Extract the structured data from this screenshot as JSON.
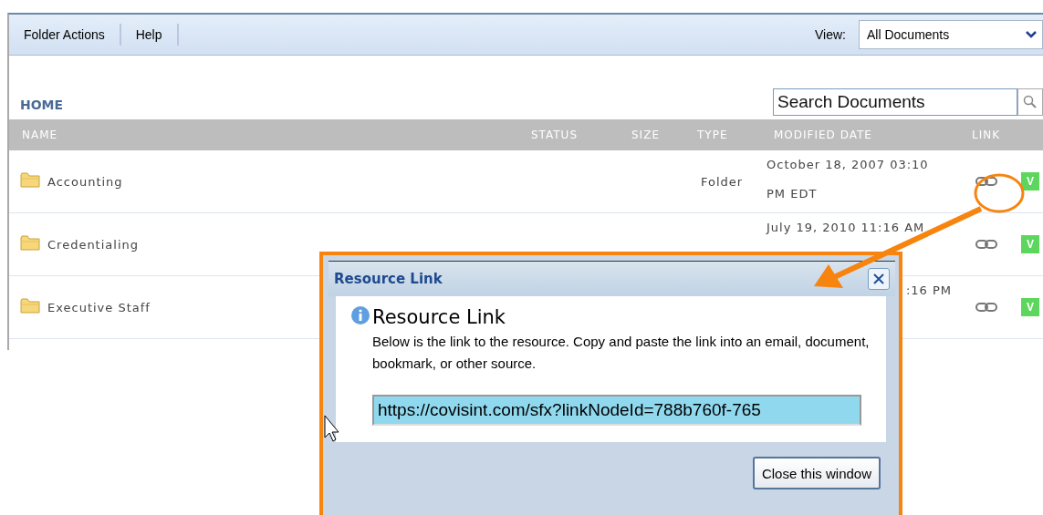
{
  "toolbar": {
    "menus": [
      "Folder Actions",
      "Help"
    ],
    "view_label": "View:",
    "view_value": "All Documents"
  },
  "breadcrumb": "HOME",
  "search": {
    "placeholder": "Search Documents"
  },
  "table": {
    "columns": [
      "NAME",
      "STATUS",
      "SIZE",
      "TYPE",
      "MODIFIED DATE",
      "LINK"
    ],
    "rows": [
      {
        "name": "Accounting",
        "type": "Folder",
        "modified": "October 18, 2007 03:10 PM EDT",
        "badge": "V"
      },
      {
        "name": "Credentialing",
        "modified": "July 19, 2010 11:16 AM",
        "badge": "V"
      },
      {
        "name": "Executive Staff",
        "modified": ":16 PM",
        "badge": "V"
      }
    ]
  },
  "dialog": {
    "title": "Resource Link",
    "heading": "Resource Link",
    "message": "Below is the link to the resource. Copy and paste the link into an email, document, bookmark, or other source.",
    "link_value": "https://covisint.com/sfx?linkNodeId=788b760f-765",
    "close_button": "Close this window"
  }
}
